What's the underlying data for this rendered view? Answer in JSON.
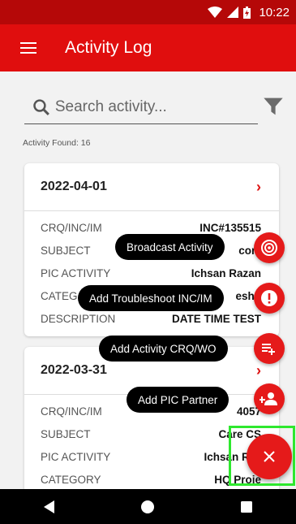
{
  "status_bar": {
    "time": "10:22"
  },
  "app_bar": {
    "title": "Activity Log"
  },
  "search": {
    "placeholder": "Search activity..."
  },
  "activity_found": "Activity Found: 16",
  "cards": [
    {
      "date": "2022-04-01",
      "rows": [
        {
          "label": "CRQ/INC/IM",
          "value": "INC#135515"
        },
        {
          "label": "SUBJECT",
          "value": "com"
        },
        {
          "label": "PIC ACTIVITY",
          "value": "Ichsan Razan"
        },
        {
          "label": "CATEG",
          "value": "esho"
        },
        {
          "label": "DESCRIPTION",
          "value": "DATE TIME TEST"
        }
      ]
    },
    {
      "date": "2022-03-31",
      "rows": [
        {
          "label": "CRQ/INC/IM",
          "value": "4057"
        },
        {
          "label": "SUBJECT",
          "value": "Care CS"
        },
        {
          "label": "PIC ACTIVITY",
          "value": "Ichsan Raz"
        },
        {
          "label": "CATEGORY",
          "value": "HQ Proje"
        }
      ]
    }
  ],
  "fab_menu": [
    {
      "label": "Broadcast Activity",
      "icon": "broadcast-icon"
    },
    {
      "label": "Add Troubleshoot INC/IM",
      "icon": "alert-icon"
    },
    {
      "label": "Add Activity CRQ/WO",
      "icon": "playlist-add-icon"
    },
    {
      "label": "Add PIC Partner",
      "icon": "person-add-icon"
    }
  ],
  "colors": {
    "primary": "#e00e0e",
    "status": "#b50808",
    "fab": "#e51a1a",
    "highlight": "#2ee82e"
  }
}
